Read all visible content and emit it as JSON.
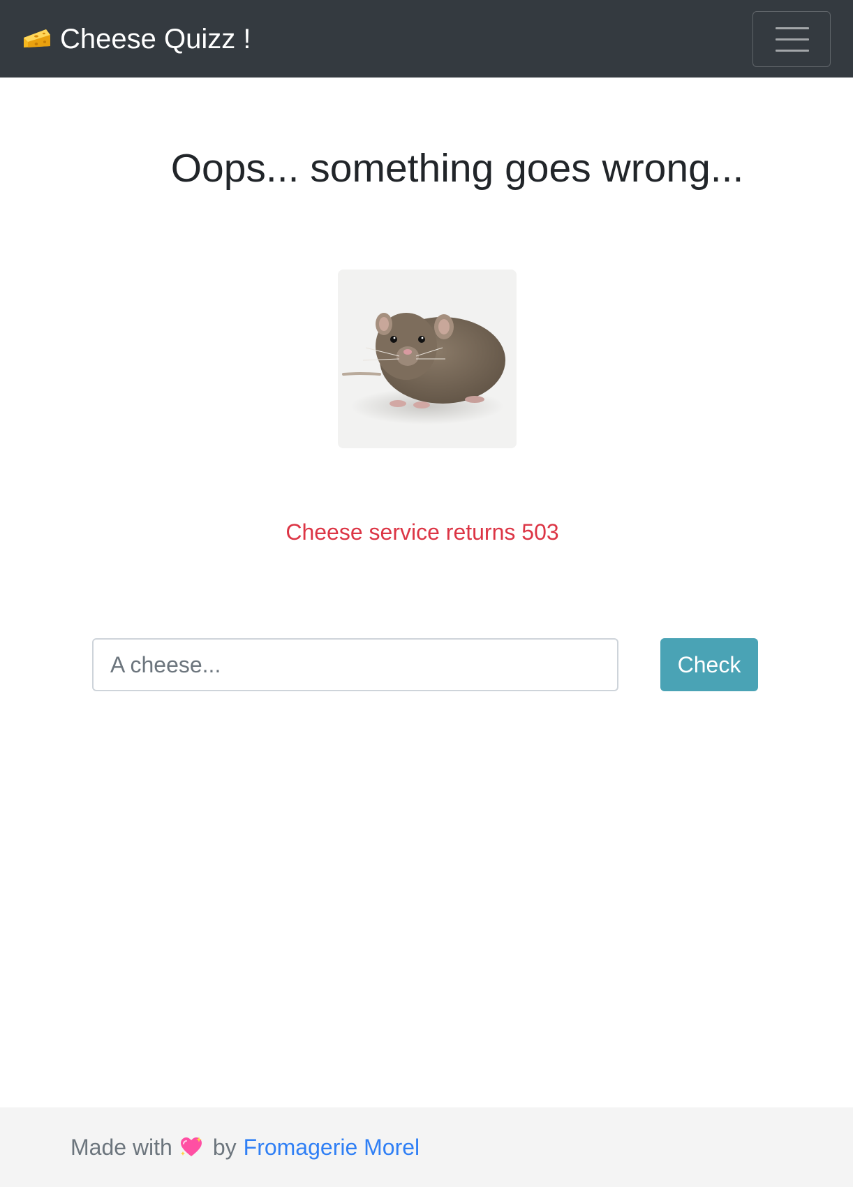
{
  "navbar": {
    "brand": "Cheese Quizz !",
    "brand_icon": "cheese-icon",
    "toggler_icon": "hamburger-menu-icon",
    "background": "#343a40"
  },
  "main": {
    "heading": "Oops... something goes wrong...",
    "image": "rat-image",
    "error_message": "Cheese service returns 503",
    "error_color": "#dc3545",
    "input": {
      "placeholder": "A cheese...",
      "value": ""
    },
    "check_button": "Check",
    "check_button_color": "#4aa3b5"
  },
  "footer": {
    "made_with": "Made with",
    "heart_icon": "sparkling-heart-icon",
    "by": "by",
    "author_link": "Fromagerie Morel",
    "link_color": "#2f7ff5"
  }
}
